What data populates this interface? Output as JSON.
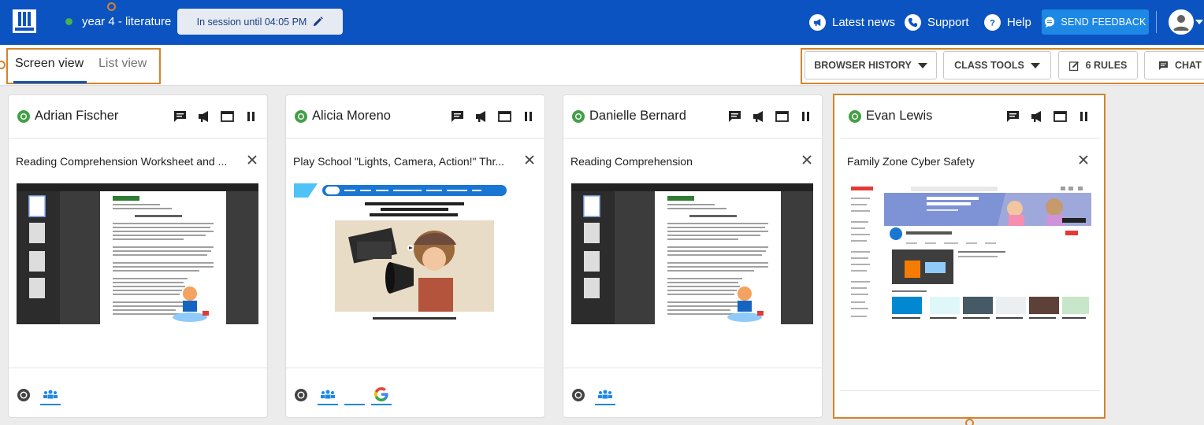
{
  "header": {
    "class_name": "year 4 - literature",
    "session_label": "In session until 04:05 PM",
    "nav": {
      "latest_news": "Latest news",
      "support": "Support",
      "help": "Help"
    },
    "feedback_label": "SEND FEEDBACK",
    "colors": {
      "bar": "#0b53c1",
      "status_dot": "#4caf50",
      "feedback": "#1e88e5"
    }
  },
  "toolbar": {
    "tabs": [
      {
        "label": "Screen view",
        "active": true
      },
      {
        "label": "List view",
        "active": false
      }
    ],
    "browser_history": "BROWSER HISTORY",
    "class_tools": "CLASS TOOLS",
    "rules": "6 RULES",
    "chat": "CHAT"
  },
  "students": [
    {
      "name": "Adrian Fischer",
      "tab_title": "Reading Comprehension Worksheet and ...",
      "footer_icons": [
        "chrome-icon",
        "group-icon"
      ]
    },
    {
      "name": "Alicia Moreno",
      "tab_title": "Play School \"Lights, Camera, Action!\" Thr...",
      "footer_icons": [
        "chrome-icon",
        "group-icon",
        "blank-icon",
        "google-icon"
      ]
    },
    {
      "name": "Danielle Bernard",
      "tab_title": "Reading Comprehension",
      "footer_icons": [
        "chrome-icon",
        "group-icon"
      ]
    },
    {
      "name": "Evan Lewis",
      "tab_title": "Family Zone Cyber Safety",
      "footer_icons": []
    }
  ]
}
